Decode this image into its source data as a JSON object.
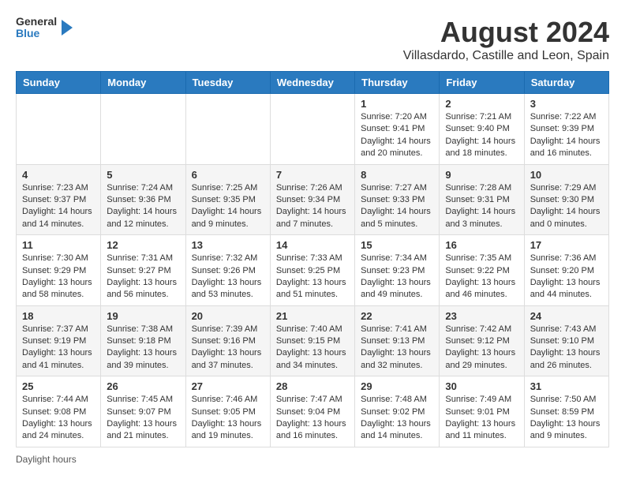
{
  "header": {
    "logo": {
      "general": "General",
      "blue": "Blue"
    },
    "title": "August 2024",
    "subtitle": "Villasdardo, Castille and Leon, Spain"
  },
  "weekdays": [
    "Sunday",
    "Monday",
    "Tuesday",
    "Wednesday",
    "Thursday",
    "Friday",
    "Saturday"
  ],
  "weeks": [
    [
      {
        "day": "",
        "sunrise": "",
        "sunset": "",
        "daylight": ""
      },
      {
        "day": "",
        "sunrise": "",
        "sunset": "",
        "daylight": ""
      },
      {
        "day": "",
        "sunrise": "",
        "sunset": "",
        "daylight": ""
      },
      {
        "day": "",
        "sunrise": "",
        "sunset": "",
        "daylight": ""
      },
      {
        "day": "1",
        "sunrise": "Sunrise: 7:20 AM",
        "sunset": "Sunset: 9:41 PM",
        "daylight": "Daylight: 14 hours and 20 minutes."
      },
      {
        "day": "2",
        "sunrise": "Sunrise: 7:21 AM",
        "sunset": "Sunset: 9:40 PM",
        "daylight": "Daylight: 14 hours and 18 minutes."
      },
      {
        "day": "3",
        "sunrise": "Sunrise: 7:22 AM",
        "sunset": "Sunset: 9:39 PM",
        "daylight": "Daylight: 14 hours and 16 minutes."
      }
    ],
    [
      {
        "day": "4",
        "sunrise": "Sunrise: 7:23 AM",
        "sunset": "Sunset: 9:37 PM",
        "daylight": "Daylight: 14 hours and 14 minutes."
      },
      {
        "day": "5",
        "sunrise": "Sunrise: 7:24 AM",
        "sunset": "Sunset: 9:36 PM",
        "daylight": "Daylight: 14 hours and 12 minutes."
      },
      {
        "day": "6",
        "sunrise": "Sunrise: 7:25 AM",
        "sunset": "Sunset: 9:35 PM",
        "daylight": "Daylight: 14 hours and 9 minutes."
      },
      {
        "day": "7",
        "sunrise": "Sunrise: 7:26 AM",
        "sunset": "Sunset: 9:34 PM",
        "daylight": "Daylight: 14 hours and 7 minutes."
      },
      {
        "day": "8",
        "sunrise": "Sunrise: 7:27 AM",
        "sunset": "Sunset: 9:33 PM",
        "daylight": "Daylight: 14 hours and 5 minutes."
      },
      {
        "day": "9",
        "sunrise": "Sunrise: 7:28 AM",
        "sunset": "Sunset: 9:31 PM",
        "daylight": "Daylight: 14 hours and 3 minutes."
      },
      {
        "day": "10",
        "sunrise": "Sunrise: 7:29 AM",
        "sunset": "Sunset: 9:30 PM",
        "daylight": "Daylight: 14 hours and 0 minutes."
      }
    ],
    [
      {
        "day": "11",
        "sunrise": "Sunrise: 7:30 AM",
        "sunset": "Sunset: 9:29 PM",
        "daylight": "Daylight: 13 hours and 58 minutes."
      },
      {
        "day": "12",
        "sunrise": "Sunrise: 7:31 AM",
        "sunset": "Sunset: 9:27 PM",
        "daylight": "Daylight: 13 hours and 56 minutes."
      },
      {
        "day": "13",
        "sunrise": "Sunrise: 7:32 AM",
        "sunset": "Sunset: 9:26 PM",
        "daylight": "Daylight: 13 hours and 53 minutes."
      },
      {
        "day": "14",
        "sunrise": "Sunrise: 7:33 AM",
        "sunset": "Sunset: 9:25 PM",
        "daylight": "Daylight: 13 hours and 51 minutes."
      },
      {
        "day": "15",
        "sunrise": "Sunrise: 7:34 AM",
        "sunset": "Sunset: 9:23 PM",
        "daylight": "Daylight: 13 hours and 49 minutes."
      },
      {
        "day": "16",
        "sunrise": "Sunrise: 7:35 AM",
        "sunset": "Sunset: 9:22 PM",
        "daylight": "Daylight: 13 hours and 46 minutes."
      },
      {
        "day": "17",
        "sunrise": "Sunrise: 7:36 AM",
        "sunset": "Sunset: 9:20 PM",
        "daylight": "Daylight: 13 hours and 44 minutes."
      }
    ],
    [
      {
        "day": "18",
        "sunrise": "Sunrise: 7:37 AM",
        "sunset": "Sunset: 9:19 PM",
        "daylight": "Daylight: 13 hours and 41 minutes."
      },
      {
        "day": "19",
        "sunrise": "Sunrise: 7:38 AM",
        "sunset": "Sunset: 9:18 PM",
        "daylight": "Daylight: 13 hours and 39 minutes."
      },
      {
        "day": "20",
        "sunrise": "Sunrise: 7:39 AM",
        "sunset": "Sunset: 9:16 PM",
        "daylight": "Daylight: 13 hours and 37 minutes."
      },
      {
        "day": "21",
        "sunrise": "Sunrise: 7:40 AM",
        "sunset": "Sunset: 9:15 PM",
        "daylight": "Daylight: 13 hours and 34 minutes."
      },
      {
        "day": "22",
        "sunrise": "Sunrise: 7:41 AM",
        "sunset": "Sunset: 9:13 PM",
        "daylight": "Daylight: 13 hours and 32 minutes."
      },
      {
        "day": "23",
        "sunrise": "Sunrise: 7:42 AM",
        "sunset": "Sunset: 9:12 PM",
        "daylight": "Daylight: 13 hours and 29 minutes."
      },
      {
        "day": "24",
        "sunrise": "Sunrise: 7:43 AM",
        "sunset": "Sunset: 9:10 PM",
        "daylight": "Daylight: 13 hours and 26 minutes."
      }
    ],
    [
      {
        "day": "25",
        "sunrise": "Sunrise: 7:44 AM",
        "sunset": "Sunset: 9:08 PM",
        "daylight": "Daylight: 13 hours and 24 minutes."
      },
      {
        "day": "26",
        "sunrise": "Sunrise: 7:45 AM",
        "sunset": "Sunset: 9:07 PM",
        "daylight": "Daylight: 13 hours and 21 minutes."
      },
      {
        "day": "27",
        "sunrise": "Sunrise: 7:46 AM",
        "sunset": "Sunset: 9:05 PM",
        "daylight": "Daylight: 13 hours and 19 minutes."
      },
      {
        "day": "28",
        "sunrise": "Sunrise: 7:47 AM",
        "sunset": "Sunset: 9:04 PM",
        "daylight": "Daylight: 13 hours and 16 minutes."
      },
      {
        "day": "29",
        "sunrise": "Sunrise: 7:48 AM",
        "sunset": "Sunset: 9:02 PM",
        "daylight": "Daylight: 13 hours and 14 minutes."
      },
      {
        "day": "30",
        "sunrise": "Sunrise: 7:49 AM",
        "sunset": "Sunset: 9:01 PM",
        "daylight": "Daylight: 13 hours and 11 minutes."
      },
      {
        "day": "31",
        "sunrise": "Sunrise: 7:50 AM",
        "sunset": "Sunset: 8:59 PM",
        "daylight": "Daylight: 13 hours and 9 minutes."
      }
    ]
  ],
  "footer": {
    "daylight_label": "Daylight hours"
  }
}
